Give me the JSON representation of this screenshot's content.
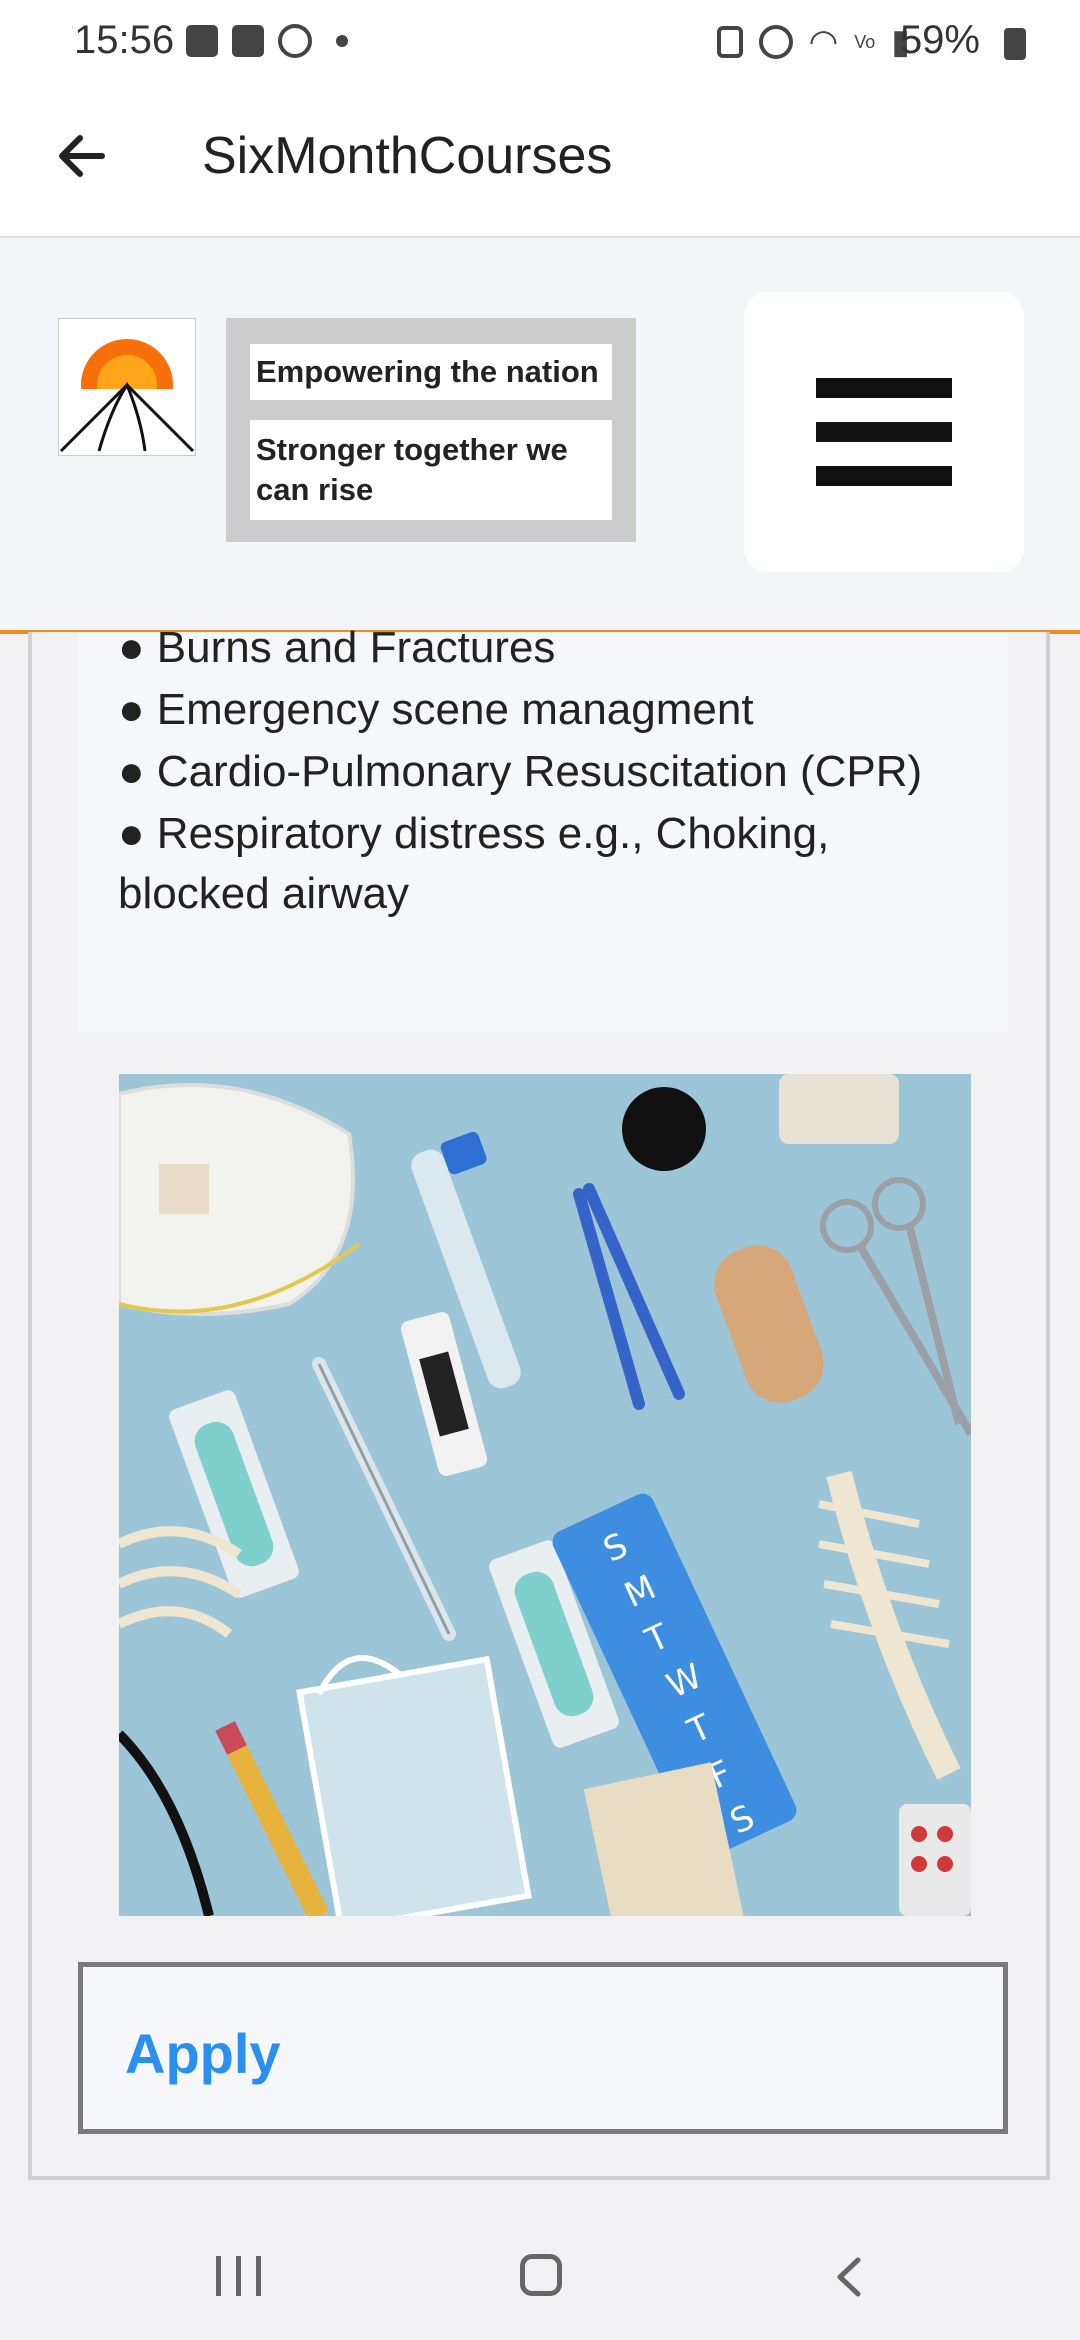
{
  "status_bar": {
    "time": "15:56",
    "battery": "59%",
    "icons_left": [
      "gallery-icon",
      "checkbox-icon",
      "whatsapp-icon",
      "dot-icon"
    ],
    "icons_right": [
      "battery-saver-icon",
      "alarm-icon",
      "wifi-icon",
      "volte-icon",
      "signal-icon",
      "battery-icon"
    ]
  },
  "app_bar": {
    "title": "SixMonthCourses",
    "back_icon": "arrow-left-icon"
  },
  "site_header": {
    "tagline_1": "Empowering the nation",
    "tagline_2": "Stronger together we can rise",
    "menu_icon": "hamburger-menu-icon",
    "accent_color": "#f08c1a"
  },
  "content": {
    "bullets": [
      "● Burns and Fractures",
      "● Emergency scene managment",
      "● Cardio-Pulmonary Resuscitation (CPR)",
      "● Respiratory distress e.g., Choking, blocked airway"
    ],
    "apply_label": "Apply",
    "apply_color": "#2b8ff0"
  },
  "nav_bar": {
    "icons": [
      "recent-apps-icon",
      "home-icon",
      "back-icon"
    ]
  }
}
